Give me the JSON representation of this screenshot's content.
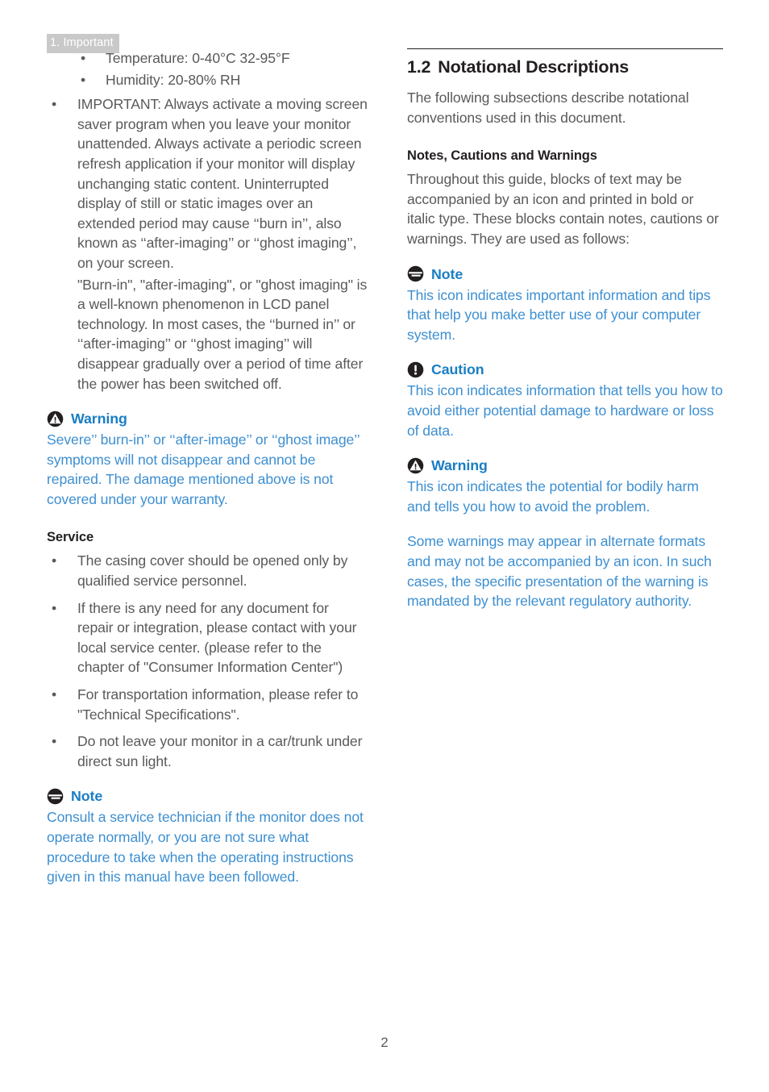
{
  "running_header": "1. Important",
  "page_number": "2",
  "colors": {
    "heading_blue": "#1a7ec4",
    "body_blue": "#3d8fd1",
    "body_gray": "#58595b",
    "header_band": "#c9c9c9",
    "icon_dark": "#231f20"
  },
  "left_column": {
    "spec_bullets": [
      "Temperature: 0-40°C 32-95°F",
      "Humidity: 20-80% RH"
    ],
    "important_bullet": "IMPORTANT: Always activate a moving screen saver program when you leave your monitor unattended. Always activate a periodic screen refresh application if your monitor will display unchanging static content. Uninterrupted display of still or static images over an extended period may cause ‘‘burn in’’, also known as ‘‘after-imaging’’ or ‘‘ghost imaging’’, on your screen.",
    "burn_in_paragraph": "\"Burn-in\", \"after-imaging\", or \"ghost imaging\" is a well-known phenomenon in LCD panel technology. In most cases, the ‘‘burned in’’ or ‘‘after-imaging’’ or ‘‘ghost imaging’’ will disappear gradually over a period of time after the power has been switched off.",
    "warning": {
      "icon": "warning-triangle-icon",
      "title": "Warning",
      "body": "Severe’’ burn-in’’ or ‘‘after-image’’ or ‘‘ghost image’’ symptoms will not disappear and cannot be repaired. The damage mentioned above is not covered under your warranty."
    },
    "service_heading": "Service",
    "service_bullets": [
      "The casing cover should be opened only by qualified service personnel.",
      "If there is any need for any document for repair or integration, please contact with your local service center. (please refer to the chapter of \"Consumer Information Center\")",
      "For transportation information, please refer to \"Technical Specifications\".",
      "Do not leave your monitor in a car/trunk under direct sun light."
    ],
    "note": {
      "icon": "note-lines-icon",
      "title": "Note",
      "body": "Consult a service technician if the monitor does not operate normally, or you are not sure what procedure to take when the operating instructions given in this manual have been followed."
    }
  },
  "right_column": {
    "section": {
      "number": "1.2",
      "title": "Notational Descriptions",
      "intro": "The following subsections describe notational conventions used in this document."
    },
    "subsection_heading": "Notes, Cautions and Warnings",
    "subsection_intro": "Throughout this guide, blocks of text may be accompanied by an icon and printed in bold or italic type. These blocks contain notes, cautions or warnings. They are used as follows:",
    "note": {
      "icon": "note-lines-icon",
      "title": "Note",
      "body": "This icon indicates important information and tips that help you make better use of your computer system."
    },
    "caution": {
      "icon": "caution-exclamation-icon",
      "title": "Caution",
      "body": "This icon indicates information that tells you how to avoid either potential damage to hardware or loss of data."
    },
    "warning": {
      "icon": "warning-triangle-icon",
      "title": "Warning",
      "body": "This icon indicates the potential for bodily harm and tells you how to avoid the problem.",
      "body2": "Some warnings may appear in alternate formats and may not be accompanied by an icon. In such cases, the specific presentation of the warning is mandated by the relevant regulatory authority."
    }
  },
  "bullet_glyph": "•"
}
